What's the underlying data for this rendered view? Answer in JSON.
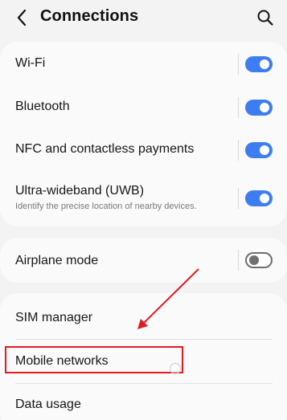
{
  "header": {
    "title": "Connections",
    "back_icon": "chevron-left-icon",
    "search_icon": "search-icon"
  },
  "settings": [
    {
      "label": "Wi-Fi",
      "toggle": "on"
    },
    {
      "label": "Bluetooth",
      "toggle": "on"
    },
    {
      "label": "NFC and contactless payments",
      "toggle": "on"
    },
    {
      "label": "Ultra-wideband (UWB)",
      "subtitle": "Identify the precise location of nearby devices.",
      "toggle": "on"
    },
    {
      "label": "Airplane mode",
      "toggle": "off"
    },
    {
      "label": "SIM manager"
    },
    {
      "label": "Mobile networks"
    },
    {
      "label": "Data usage"
    }
  ],
  "annotation": {
    "highlighted_item": "Mobile networks",
    "color": "#e01b24"
  },
  "colors": {
    "background": "#f3f3f3",
    "card": "#fafafa",
    "toggle_on": "#3e7df1",
    "toggle_off": "#6e6e6e"
  }
}
